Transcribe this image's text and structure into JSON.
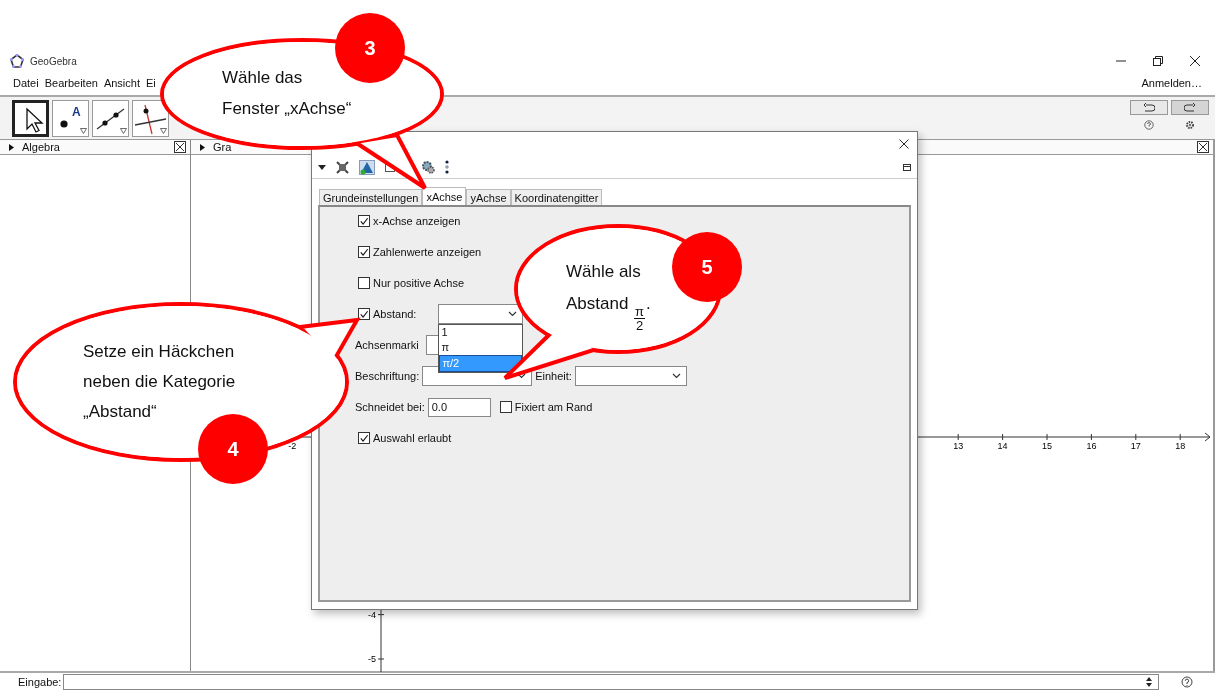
{
  "window": {
    "title": "GeoGebra"
  },
  "menu": [
    {
      "label": "Datei"
    },
    {
      "label": "Bearbeiten"
    },
    {
      "label": "Ansicht"
    },
    {
      "label": "Ei"
    }
  ],
  "account_link": "Anmelden…",
  "toolbar": {
    "tools": [
      {
        "kind": "move",
        "selected": true
      },
      {
        "kind": "point",
        "label": "A",
        "selected": false
      },
      {
        "kind": "line",
        "selected": false
      },
      {
        "kind": "perpendicular",
        "selected": false
      }
    ]
  },
  "panels": [
    {
      "title": "Algebra"
    },
    {
      "title": "Gra"
    }
  ],
  "graphics": {
    "x_ticks": [
      "-2",
      "13",
      "14",
      "15",
      "16",
      "17",
      "18"
    ],
    "y_ticks": [
      "-4",
      "-5"
    ]
  },
  "dialog": {
    "tabs": [
      {
        "label": "Grundeinstellungen",
        "selected": false
      },
      {
        "label": "xAchse",
        "selected": true
      },
      {
        "label": "yAchse",
        "selected": false
      },
      {
        "label": "Koordinatengitter",
        "selected": false
      }
    ],
    "options": [
      {
        "kind": "checkbox",
        "label": "x-Achse anzeigen",
        "checked": true
      },
      {
        "kind": "checkbox",
        "label": "Zahlenwerte anzeigen",
        "checked": true
      },
      {
        "kind": "checkbox",
        "label": "Nur positive Achse",
        "checked": false
      },
      {
        "kind": "checkbox-dropdown",
        "label": "Abstand:",
        "checked": true,
        "expanded": true,
        "options": [
          {
            "label": "1",
            "selected": false
          },
          {
            "label": "π",
            "selected": false
          },
          {
            "label": "π/2",
            "selected": true
          }
        ]
      },
      {
        "kind": "dropdown",
        "label": "Achsenmarki"
      },
      {
        "kind": "dropdown-pair",
        "label": "Beschriftung:",
        "label_2": "Einheit:"
      },
      {
        "kind": "input-checkbox",
        "label": "Schneidet bei:",
        "value": "0.0",
        "checkbox_label": "Fixiert am Rand",
        "checked": false
      },
      {
        "kind": "checkbox",
        "label": "Auswahl erlaubt",
        "checked": true
      }
    ]
  },
  "input_bar": {
    "label": "Eingabe:"
  },
  "callouts": [
    {
      "number": "3",
      "text": "Wähle das\nFenster „xAchse“"
    },
    {
      "number": "5",
      "text": "Wähle als\nAbstand ",
      "fraction": {
        "numerator": "π",
        "denominator": "2"
      },
      "end": "."
    },
    {
      "number": "4",
      "text": "Setze ein Häckchen\nneben die Kategorie\n„Abstand“"
    }
  ]
}
